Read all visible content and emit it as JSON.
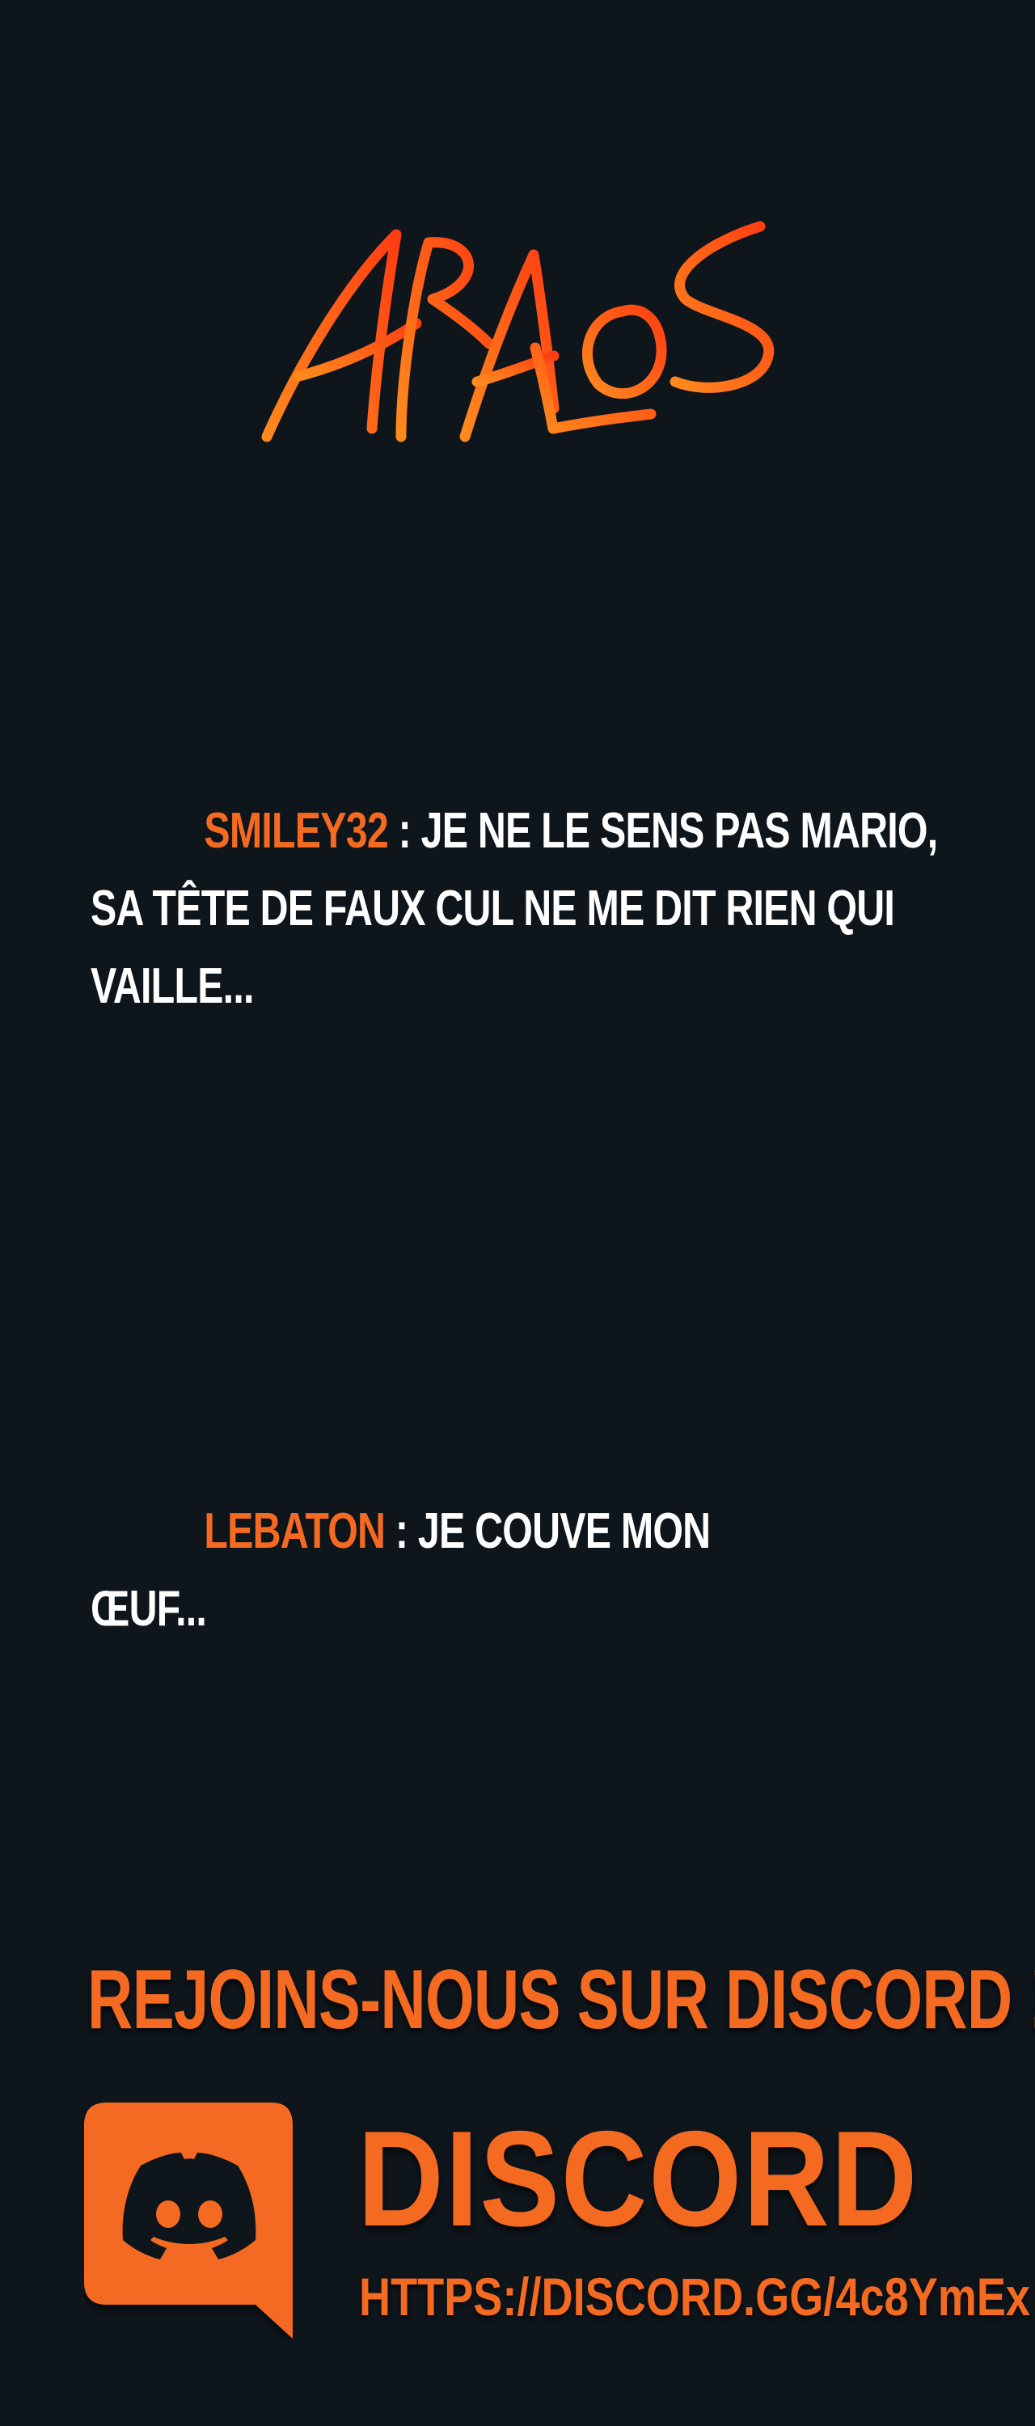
{
  "logo": {
    "text": "ARALOS",
    "colors": [
      "#ff8a1e",
      "#ff3d12"
    ]
  },
  "messages": [
    {
      "user": "SMILEY32",
      "separator": " : ",
      "text": "JE NE LE SENS PAS MARIO, SA TÊTE DE FAUX CUL NE ME DIT RIEN QUI VAILLE..."
    },
    {
      "user": "LEBATON",
      "separator": " : ",
      "text": "JE COUVE MON ŒUF..."
    }
  ],
  "discord": {
    "heading": "REJOINS-NOUS SUR DISCORD !",
    "icon": "discord-icon",
    "wordmark": "DISCORD",
    "url": "HTTPS://DISCORD.GG/4c8YmEx"
  },
  "colors": {
    "background": "#0e151b",
    "accent": "#f46a21",
    "text": "#ffffff"
  }
}
